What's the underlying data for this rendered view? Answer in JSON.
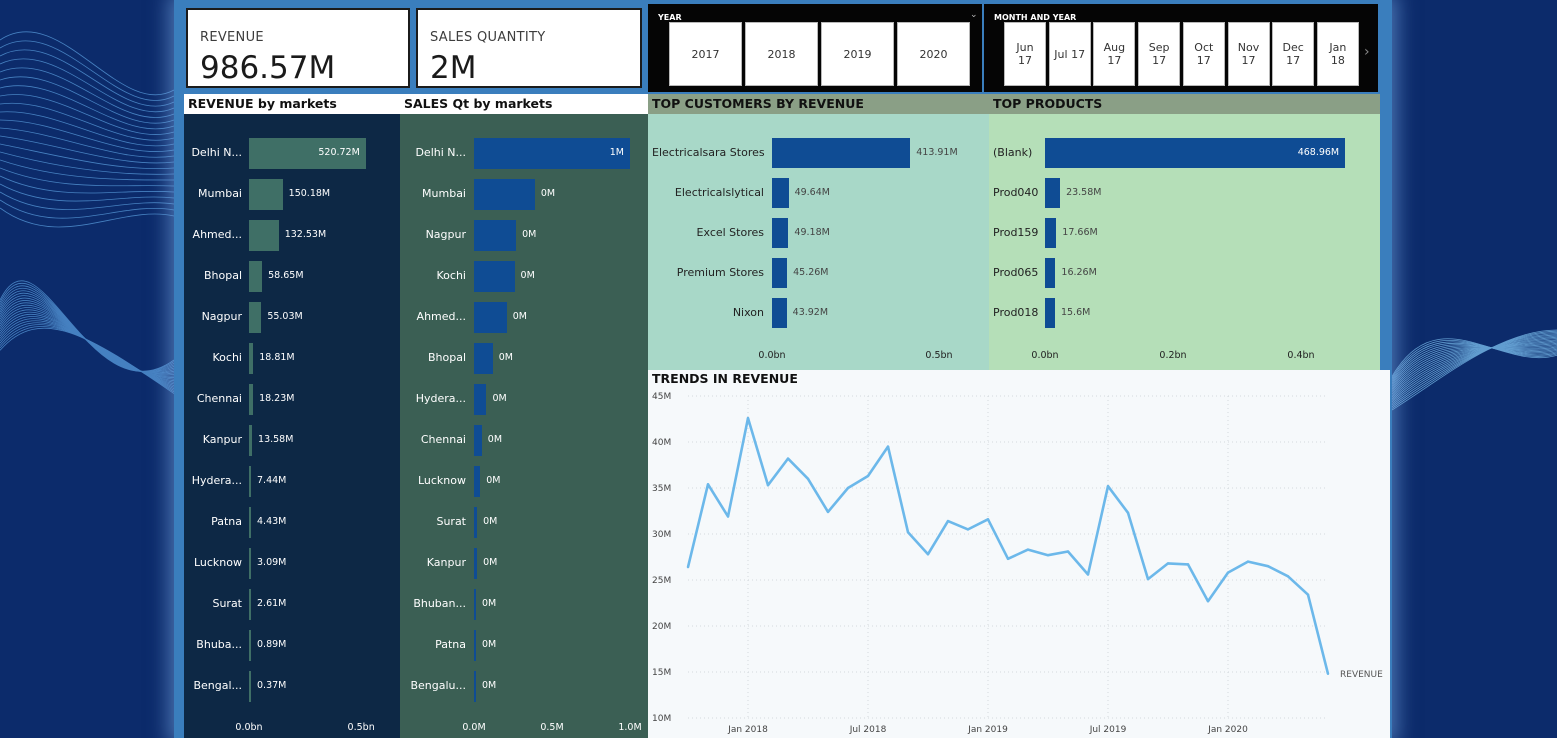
{
  "cards": {
    "revenue": {
      "label": "REVENUE",
      "value": "986.57M"
    },
    "sales_qty": {
      "label": "SALES QUANTITY",
      "value": "2M"
    }
  },
  "year_slicer": {
    "title": "YEAR",
    "options": [
      "2017",
      "2018",
      "2019",
      "2020"
    ]
  },
  "month_slicer": {
    "title": "MONTH AND YEAR",
    "options": [
      "Jun\n17",
      "Jul 17",
      "Aug\n17",
      "Sep\n17",
      "Oct\n17",
      "Nov\n17",
      "Dec\n17",
      "Jan\n18"
    ]
  },
  "revenue_by_markets": {
    "title": "REVENUE by markets",
    "labels": [
      "Delhi N...",
      "Mumbai",
      "Ahmed...",
      "Bhopal",
      "Nagpur",
      "Kochi",
      "Chennai",
      "Kanpur",
      "Hydera...",
      "Patna",
      "Lucknow",
      "Surat",
      "Bhuba...",
      "Bengal..."
    ],
    "values": [
      520.72,
      150.18,
      132.53,
      58.65,
      55.03,
      18.81,
      18.23,
      13.58,
      7.44,
      4.43,
      3.09,
      2.61,
      0.89,
      0.37
    ],
    "value_labels": [
      "520.72M",
      "150.18M",
      "132.53M",
      "58.65M",
      "55.03M",
      "18.81M",
      "18.23M",
      "13.58M",
      "7.44M",
      "4.43M",
      "3.09M",
      "2.61M",
      "0.89M",
      "0.37M"
    ],
    "axis_ticks": [
      "0.0bn",
      "0.5bn"
    ]
  },
  "sales_by_markets": {
    "title": "SALES Qt by markets",
    "labels": [
      "Delhi N...",
      "Mumbai",
      "Nagpur",
      "Kochi",
      "Ahmed...",
      "Bhopal",
      "Hydera...",
      "Chennai",
      "Lucknow",
      "Surat",
      "Kanpur",
      "Bhuban...",
      "Patna",
      "Bengalu..."
    ],
    "values": [
      1.0,
      0.39,
      0.27,
      0.26,
      0.21,
      0.12,
      0.08,
      0.05,
      0.04,
      0.02,
      0.02,
      0.01,
      0.01,
      0.005
    ],
    "value_labels": [
      "1M",
      "0M",
      "0M",
      "0M",
      "0M",
      "0M",
      "0M",
      "0M",
      "0M",
      "0M",
      "0M",
      "0M",
      "0M",
      "0M"
    ],
    "axis_ticks": [
      "0.0M",
      "0.5M",
      "1.0M"
    ]
  },
  "top_customers": {
    "title": "TOP CUSTOMERS BY REVENUE",
    "labels": [
      "Electricalsara Stores",
      "Electricalslytical",
      "Excel Stores",
      "Premium Stores",
      "Nixon"
    ],
    "values": [
      413.91,
      49.64,
      49.18,
      45.26,
      43.92
    ],
    "value_labels": [
      "413.91M",
      "49.64M",
      "49.18M",
      "45.26M",
      "43.92M"
    ],
    "axis_ticks": [
      "0.0bn",
      "0.5bn"
    ]
  },
  "top_products": {
    "title": "TOP PRODUCTS",
    "labels": [
      "(Blank)",
      "Prod040",
      "Prod159",
      "Prod065",
      "Prod018"
    ],
    "values": [
      468.96,
      23.58,
      17.66,
      16.26,
      15.6
    ],
    "value_labels": [
      "468.96M",
      "23.58M",
      "17.66M",
      "16.26M",
      "15.6M"
    ],
    "axis_ticks": [
      "0.0bn",
      "0.2bn",
      "0.4bn"
    ]
  },
  "chart_data": {
    "type": "line",
    "title": "TRENDS IN REVENUE",
    "series": [
      {
        "name": "REVENUE",
        "values": [
          26.4,
          35.4,
          31.9,
          42.6,
          35.3,
          38.2,
          36.0,
          32.4,
          35.0,
          36.3,
          39.5,
          30.2,
          27.8,
          31.4,
          30.5,
          31.6,
          27.3,
          28.3,
          27.7,
          28.1,
          25.6,
          35.2,
          32.3,
          25.1,
          26.8,
          26.7,
          22.7,
          25.8,
          27.0,
          26.5,
          25.4,
          23.4,
          14.8
        ]
      }
    ],
    "x": [
      "2017-10",
      "2017-11",
      "2017-12",
      "2018-01",
      "2018-02",
      "2018-03",
      "2018-04",
      "2018-05",
      "2018-06",
      "2018-07",
      "2018-08",
      "2018-09",
      "2018-10",
      "2018-11",
      "2018-12",
      "2019-01",
      "2019-02",
      "2019-03",
      "2019-04",
      "2019-05",
      "2019-06",
      "2019-07",
      "2019-08",
      "2019-09",
      "2019-10",
      "2019-11",
      "2019-12",
      "2020-01",
      "2020-02",
      "2020-03",
      "2020-04",
      "2020-05",
      "2020-06"
    ],
    "x_tick_labels": [
      "Jan 2018",
      "Jul 2018",
      "Jan 2019",
      "Jul 2019",
      "Jan 2020"
    ],
    "y_tick_labels": [
      "45M",
      "40M",
      "35M",
      "30M",
      "25M",
      "20M",
      "15M",
      "10M"
    ],
    "ylim": [
      10,
      45
    ],
    "ylabel_unit": "M",
    "grid": true,
    "color": "#6cb8ea"
  },
  "colors": {
    "revenue_bar": "#3f6f66",
    "revenue_bg": "#0d2845",
    "sales_bar": "#0f4c94",
    "sales_bg": "#3b5f54",
    "cust_bar": "#0f4c94",
    "cust_bg": "#a8d8c8",
    "prod_bar": "#0f4c94",
    "prod_bg": "#b5dfb8"
  }
}
